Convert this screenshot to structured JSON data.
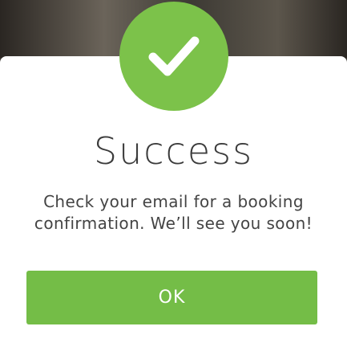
{
  "dialog": {
    "icon": "checkmark-icon",
    "title": "Success",
    "message": "Check your email for a booking confirmation. We’ll see you soon!",
    "ok_label": "OK"
  },
  "colors": {
    "accent": "#7cc24a",
    "button": "#74bd47",
    "text": "#3b3b3b"
  }
}
